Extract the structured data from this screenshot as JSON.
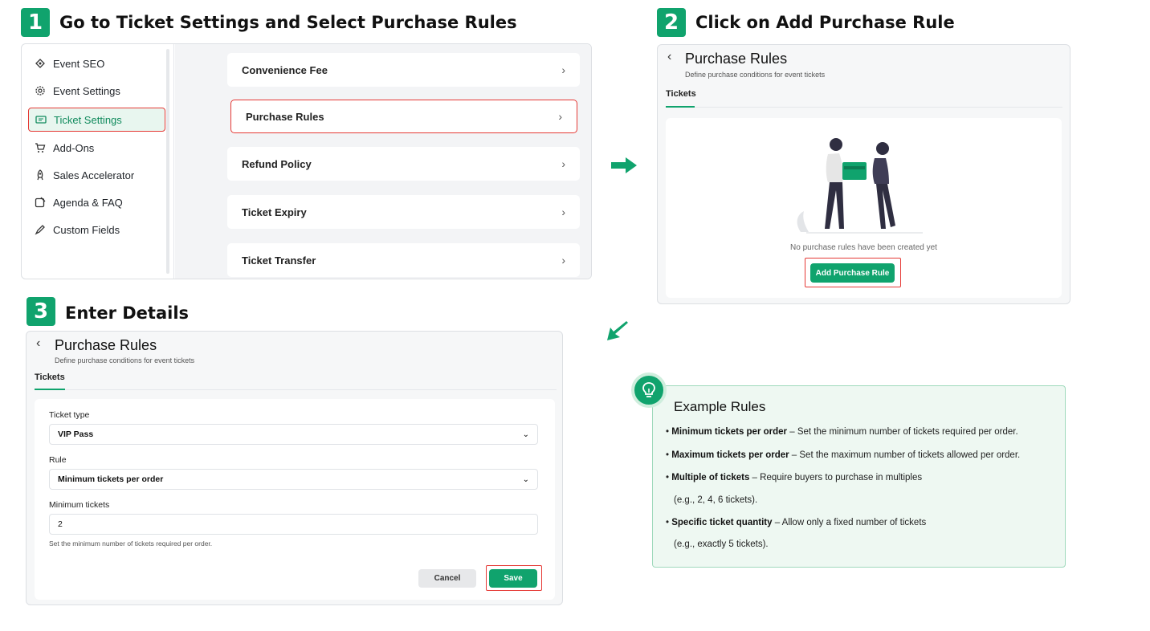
{
  "steps": [
    {
      "num": "1",
      "title": "Go to Ticket Settings and Select Purchase Rules"
    },
    {
      "num": "2",
      "title": "Click on Add Purchase Rule"
    },
    {
      "num": "3",
      "title": "Enter Details"
    }
  ],
  "sidebar": {
    "items": [
      {
        "label": "Event SEO",
        "icon": "seo-icon"
      },
      {
        "label": "Event Settings",
        "icon": "gear-icon"
      },
      {
        "label": "Ticket Settings",
        "icon": "ticket-icon",
        "active": true
      },
      {
        "label": "Add-Ons",
        "icon": "cart-icon"
      },
      {
        "label": "Sales Accelerator",
        "icon": "rocket-icon"
      },
      {
        "label": "Agenda & FAQ",
        "icon": "agenda-icon"
      },
      {
        "label": "Custom Fields",
        "icon": "fields-icon"
      }
    ]
  },
  "settings_list": [
    {
      "label": "Convenience Fee"
    },
    {
      "label": "Purchase Rules",
      "highlighted": true
    },
    {
      "label": "Refund Policy"
    },
    {
      "label": "Ticket Expiry"
    },
    {
      "label": "Ticket Transfer"
    }
  ],
  "purchase_rules_page": {
    "title": "Purchase Rules",
    "subtitle": "Define purchase conditions for event tickets",
    "tab": "Tickets",
    "empty_text": "No purchase rules have been created yet",
    "add_button": "Add Purchase Rule"
  },
  "form": {
    "title": "Purchase Rules",
    "subtitle": "Define purchase conditions for event tickets",
    "tab": "Tickets",
    "ticket_type_label": "Ticket type",
    "ticket_type_value": "VIP Pass",
    "rule_label": "Rule",
    "rule_value": "Minimum tickets per order",
    "min_label": "Minimum tickets",
    "min_value": "2",
    "help": "Set the minimum number of tickets required per order.",
    "cancel": "Cancel",
    "save": "Save"
  },
  "examples": {
    "title": "Example Rules",
    "items": [
      {
        "bold": "Minimum tickets per order",
        "text": " – Set the minimum number of tickets required per order."
      },
      {
        "bold": "Maximum tickets per order",
        "text": " – Set the maximum number of tickets allowed per order."
      },
      {
        "bold": "Multiple of tickets",
        "text": " – Require buyers to purchase in multiples",
        "cont": "(e.g., 2, 4, 6 tickets)."
      },
      {
        "bold": "Specific ticket quantity",
        "text": " –  Allow only a fixed number of tickets",
        "cont": "(e.g., exactly 5 tickets)."
      }
    ]
  },
  "colors": {
    "accent": "#10a36d",
    "highlight": "#e53935"
  }
}
